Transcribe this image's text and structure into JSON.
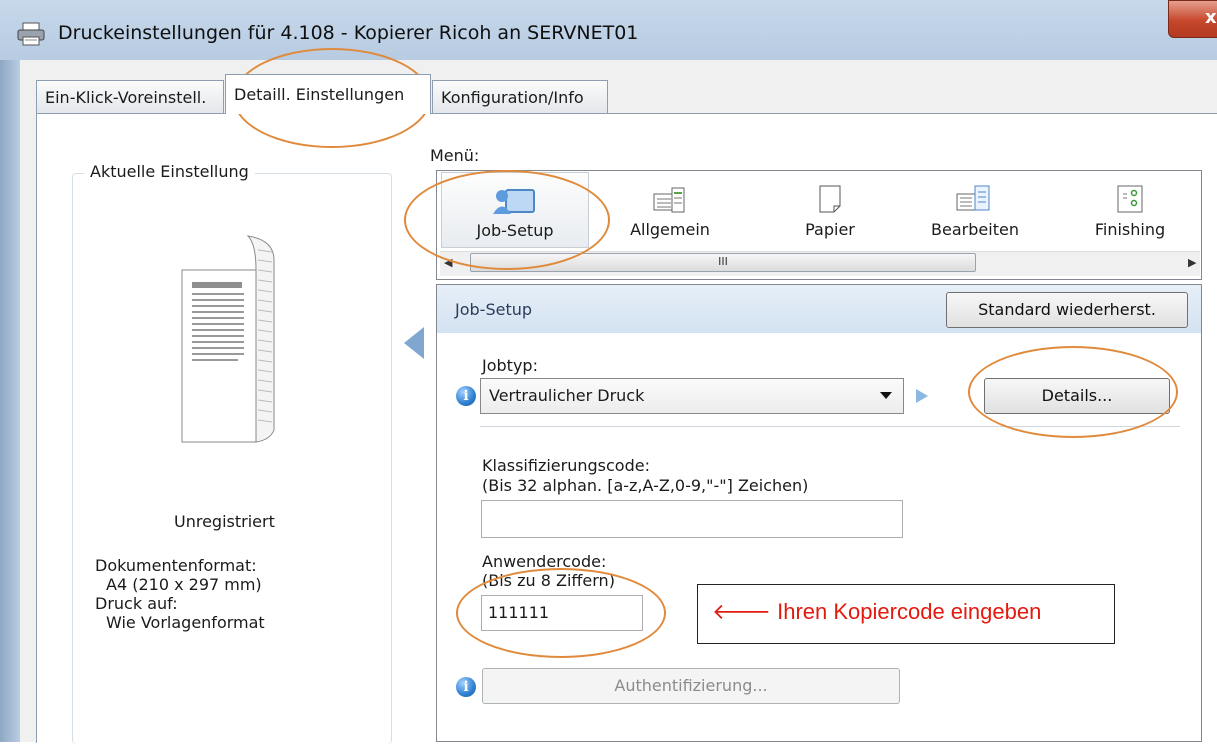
{
  "window": {
    "title": "Druckeinstellungen für 4.108 - Kopierer Ricoh an SERVNET01",
    "close_glyph": "x"
  },
  "tabs": [
    {
      "label": "Ein-Klick-Voreinstell."
    },
    {
      "label": "Detaill. Einstellungen",
      "active": true
    },
    {
      "label": "Konfiguration/Info"
    }
  ],
  "left_panel": {
    "group_title": "Aktuelle Einstellung",
    "status": "Unregistriert",
    "doc_format_label": "Dokumentenformat:",
    "doc_format_value": "A4 (210 x 297 mm)",
    "print_on_label": "Druck auf:",
    "print_on_value": "Wie Vorlagenformat"
  },
  "menu": {
    "label": "Menü:",
    "items": [
      {
        "label": "Job-Setup",
        "icon": "job-setup-icon",
        "selected": true
      },
      {
        "label": "Allgemein",
        "icon": "general-icon"
      },
      {
        "label": "Papier",
        "icon": "paper-icon"
      },
      {
        "label": "Bearbeiten",
        "icon": "edit-icon"
      },
      {
        "label": "Finishing",
        "icon": "finishing-icon"
      }
    ],
    "scroll_thumb_glyph": "III"
  },
  "section": {
    "title": "Job-Setup",
    "restore_button": "Standard wiederherst.",
    "jobtyp_label": "Jobtyp:",
    "jobtyp_value": "Vertraulicher Druck",
    "details_button": "Details...",
    "class_code_label": "Klassifizierungscode:",
    "class_code_hint": "(Bis 32 alphan. [a-z,A-Z,0-9,\"-\"] Zeichen)",
    "class_code_value": "",
    "user_code_label": "Anwendercode:",
    "user_code_hint": "(Bis zu 8 Ziffern)",
    "user_code_value": "111111",
    "auth_button": "Authentifizierung..."
  },
  "annotation": {
    "arrow": "🡐",
    "text": "Ihren Kopiercode eingeben",
    "ellipse_color": "#e08a3c",
    "text_color": "#e31b0f"
  }
}
